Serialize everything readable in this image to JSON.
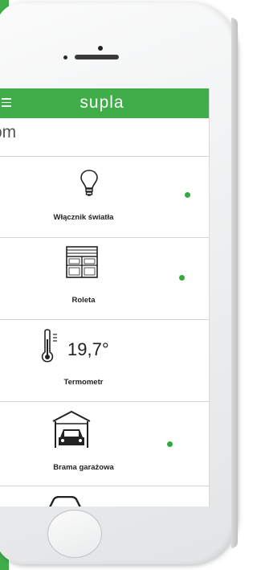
{
  "app": {
    "title": "supla"
  },
  "location": {
    "name": "om"
  },
  "channels": [
    {
      "caption": "Włącznik światła",
      "icon": "lightbulb-icon",
      "status": "online"
    },
    {
      "caption": "Roleta",
      "icon": "roller-shutter-icon",
      "status": "online"
    },
    {
      "caption": "Termometr",
      "icon": "thermometer-icon",
      "value": "19,7°"
    },
    {
      "caption": "Brama garażowa",
      "icon": "garage-gate-icon",
      "status": "online"
    },
    {
      "caption": "",
      "icon": "car-roof-icon"
    }
  ],
  "colors": {
    "accent": "#3fae49",
    "status_online": "#2eaa3e"
  }
}
